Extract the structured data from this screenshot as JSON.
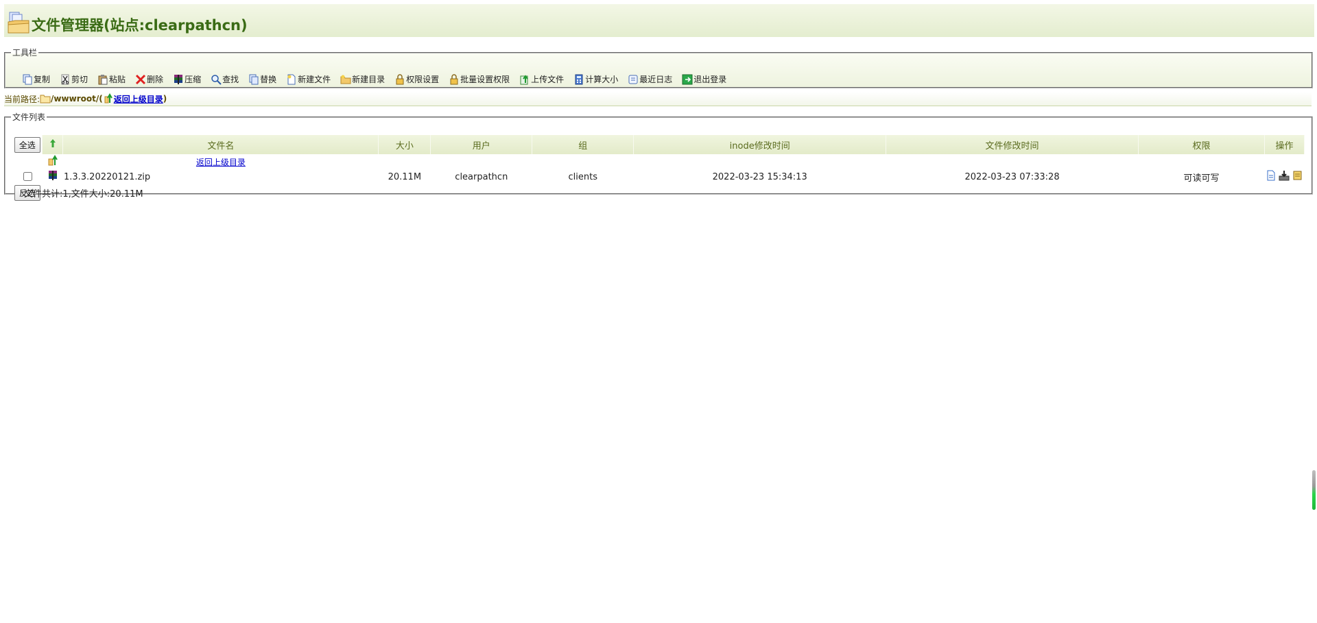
{
  "app": {
    "title": "文件管理器(站点:clearpathcn)"
  },
  "toolbar": {
    "legend": "工具栏",
    "items": [
      {
        "label": "复制",
        "icon": "copy-icon"
      },
      {
        "label": "剪切",
        "icon": "cut-icon"
      },
      {
        "label": "粘贴",
        "icon": "paste-icon"
      },
      {
        "label": "删除",
        "icon": "delete-icon"
      },
      {
        "label": "压缩",
        "icon": "compress-icon"
      },
      {
        "label": "查找",
        "icon": "search-icon"
      },
      {
        "label": "替换",
        "icon": "replace-icon"
      },
      {
        "label": "新建文件",
        "icon": "new-file-icon"
      },
      {
        "label": "新建目录",
        "icon": "new-folder-icon"
      },
      {
        "label": "权限设置",
        "icon": "lock-icon"
      },
      {
        "label": "批量设置权限",
        "icon": "batch-lock-icon"
      },
      {
        "label": "上传文件",
        "icon": "upload-icon"
      },
      {
        "label": "计算大小",
        "icon": "calculator-icon"
      },
      {
        "label": "最近日志",
        "icon": "log-icon"
      },
      {
        "label": "退出登录",
        "icon": "logout-icon"
      }
    ]
  },
  "path": {
    "label": "当前路径:",
    "value": "/wwwroot/",
    "open_paren": "(",
    "parent_link": "返回上级目录",
    "close_paren": ")"
  },
  "files": {
    "legend": "文件列表",
    "select_all": "全选",
    "invert": "反选",
    "columns": {
      "name": "文件名",
      "size": "大小",
      "user": "用户",
      "group": "组",
      "inode_time": "inode修改时间",
      "mod_time": "文件修改时间",
      "perm": "权限",
      "ops": "操作"
    },
    "parent_row_link": "返回上级目录",
    "rows": [
      {
        "name": "1.3.3.20220121.zip",
        "size": "20.11M",
        "user": "clearpathcn",
        "group": "clients",
        "inode_time": "2022-03-23 15:34:13",
        "mod_time": "2022-03-23 07:33:28",
        "perm": "可读可写"
      }
    ],
    "summary": "文件共计:1,文件大小:20.11M"
  },
  "colors": {
    "title": "#3a6b15",
    "header_bg": "#e4edcf",
    "link": "#0000cc"
  }
}
